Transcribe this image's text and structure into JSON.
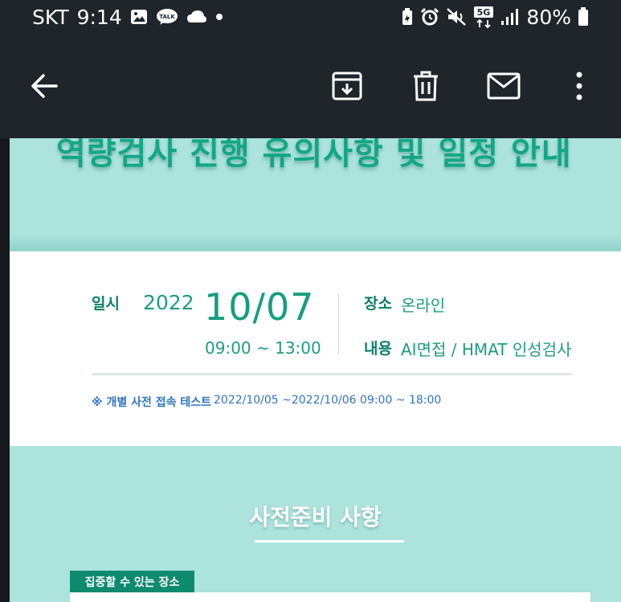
{
  "status_bar": {
    "carrier": "SKT",
    "time": "9:14",
    "battery": "80%",
    "left_icons": [
      "gallery-icon",
      "kakaotalk-icon",
      "cloud-icon",
      "dot-icon"
    ],
    "kakao_text": "TALK",
    "right_icons": [
      "battery-saver-icon",
      "alarm-icon",
      "mute-icon",
      "5g-icon",
      "signal-icon",
      "battery-icon"
    ],
    "network": "5G"
  },
  "app_bar": {
    "back_icon": "arrow-back-icon",
    "actions": [
      "archive-icon",
      "delete-icon",
      "mark-unread-icon",
      "more-vert-icon"
    ]
  },
  "email": {
    "hero_title": "역량검사 진행 유의사항 및 일정 안내",
    "info": {
      "date_label": "일시",
      "year": "2022",
      "date": "10/07",
      "time": "09:00 ~ 13:00",
      "place_label": "장소",
      "place": "온라인",
      "content_label": "내용",
      "content": "AI면접 / HMAT 인성검사"
    },
    "notice": {
      "label": "※ 개별 사전 접속 테스트",
      "value": "2022/10/05 ~2022/10/06  09:00 ~ 18:00"
    },
    "section_title": "사전준비 사항",
    "tag": "집중할 수 있는 장소"
  },
  "colors": {
    "appbar_bg": "#1f252b",
    "email_bg": "#ade3dd",
    "accent_green": "#12a785",
    "notice_blue": "#2f74c4",
    "tag_green": "#0e8a6f"
  }
}
